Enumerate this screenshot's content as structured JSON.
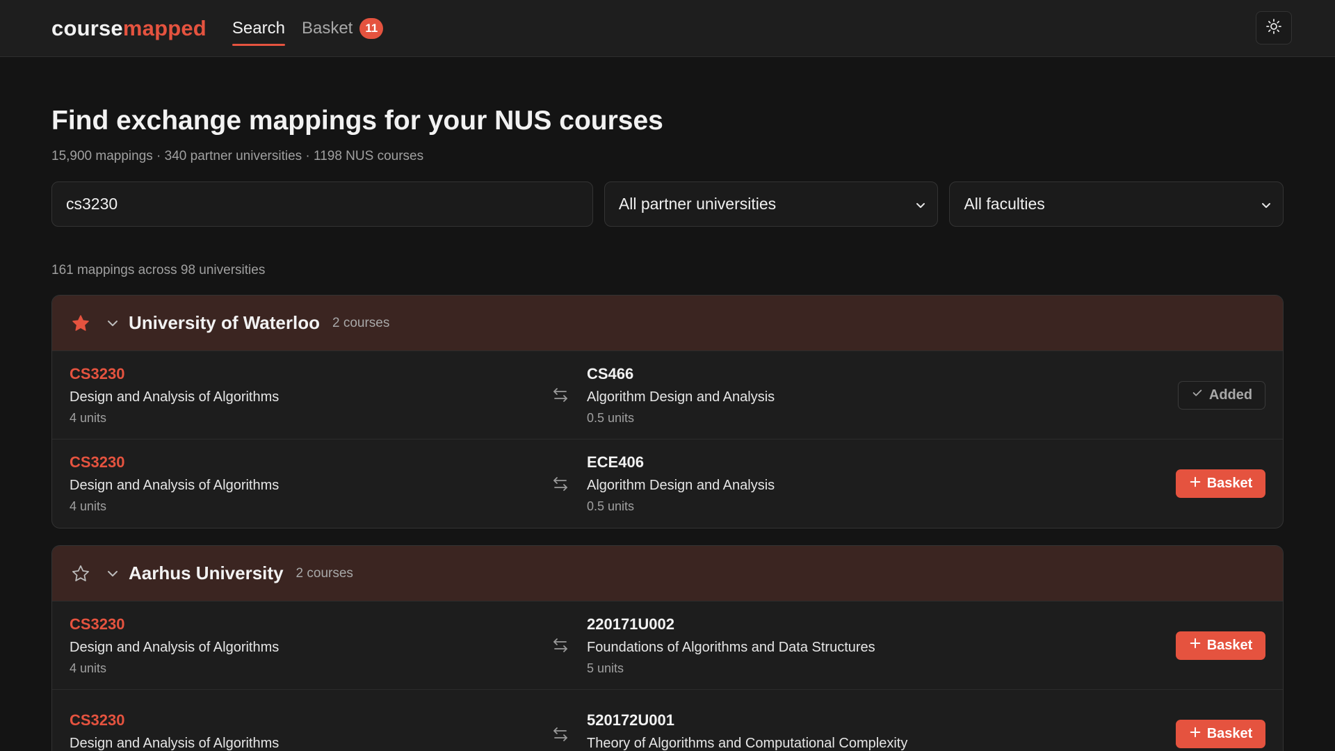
{
  "app": {
    "logo_part1": "course",
    "logo_part2": "mapped",
    "brand_color": "#e5533f"
  },
  "nav": {
    "tabs": [
      {
        "label": "Search",
        "active": true
      },
      {
        "label": "Basket",
        "badge": "11"
      }
    ],
    "theme_toggle_icon": "sun-icon"
  },
  "header": {
    "title": "Find exchange mappings for your NUS courses",
    "subtitle": "15,900 mappings · 340 partner universities · 1198 NUS courses"
  },
  "filters": {
    "search_value": "cs3230",
    "university_select": "All partner universities",
    "faculty_select": "All faculties"
  },
  "results": {
    "summary": "161 mappings across 98 universities",
    "universities": [
      {
        "name": "University of Waterloo",
        "count": "2 courses",
        "starred": true,
        "mappings": [
          {
            "nus_code": "CS3230",
            "nus_name": "Design and Analysis of Algorithms",
            "nus_units": "4 units",
            "partner_code": "CS466",
            "partner_name": "Algorithm Design and Analysis",
            "partner_units": "0.5 units",
            "action": "Added"
          },
          {
            "nus_code": "CS3230",
            "nus_name": "Design and Analysis of Algorithms",
            "nus_units": "4 units",
            "partner_code": "ECE406",
            "partner_name": "Algorithm Design and Analysis",
            "partner_units": "0.5 units",
            "action": "Basket"
          }
        ]
      },
      {
        "name": "Aarhus University",
        "count": "2 courses",
        "starred": false,
        "mappings": [
          {
            "nus_code": "CS3230",
            "nus_name": "Design and Analysis of Algorithms",
            "nus_units": "4 units",
            "partner_code": "220171U002",
            "partner_name": "Foundations of Algorithms and Data Structures",
            "partner_units": "5 units",
            "action": "Basket"
          },
          {
            "nus_code": "CS3230",
            "nus_name": "Design and Analysis of Algorithms",
            "nus_units": "",
            "partner_code": "520172U001",
            "partner_name": "Theory of Algorithms and Computational Complexity",
            "partner_units": "",
            "action": "Basket"
          }
        ]
      }
    ]
  }
}
